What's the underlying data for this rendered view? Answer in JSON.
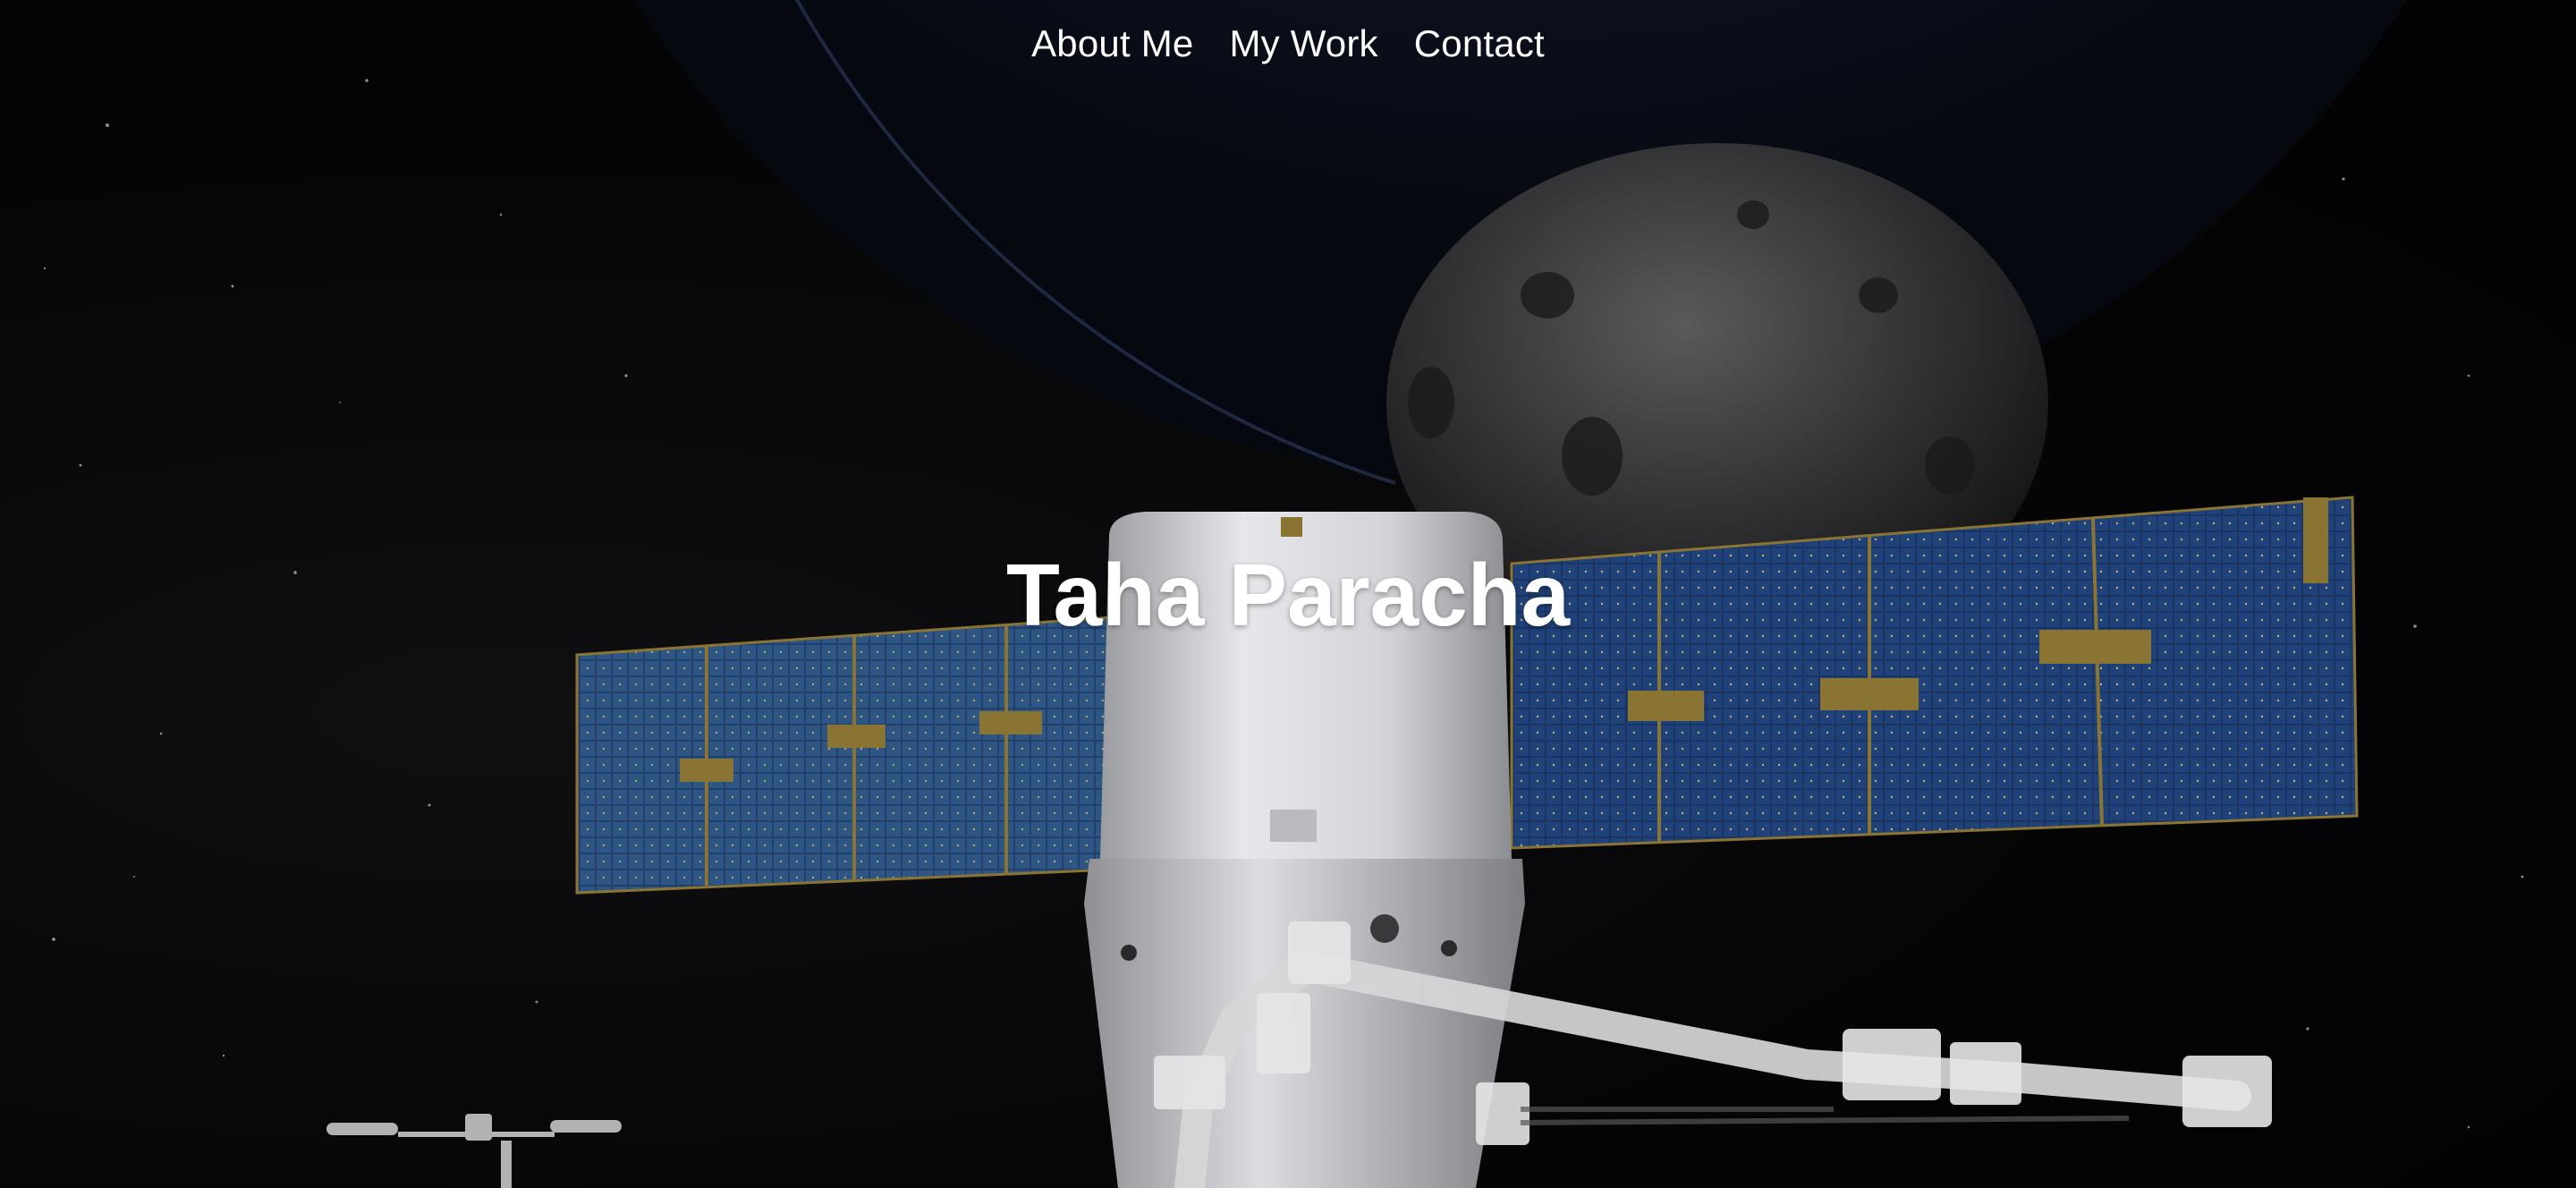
{
  "nav": {
    "items": [
      {
        "label": "About Me"
      },
      {
        "label": "My Work"
      },
      {
        "label": "Contact"
      }
    ]
  },
  "hero": {
    "title": "Taha Paracha"
  },
  "colors": {
    "background": "#040405",
    "text": "#ffffff",
    "panel_blue": "#1d3a66",
    "panel_gold": "#8a7434",
    "capsule": "#d9dbde"
  },
  "icons": {
    "background_image": "space-scene-illustration"
  }
}
